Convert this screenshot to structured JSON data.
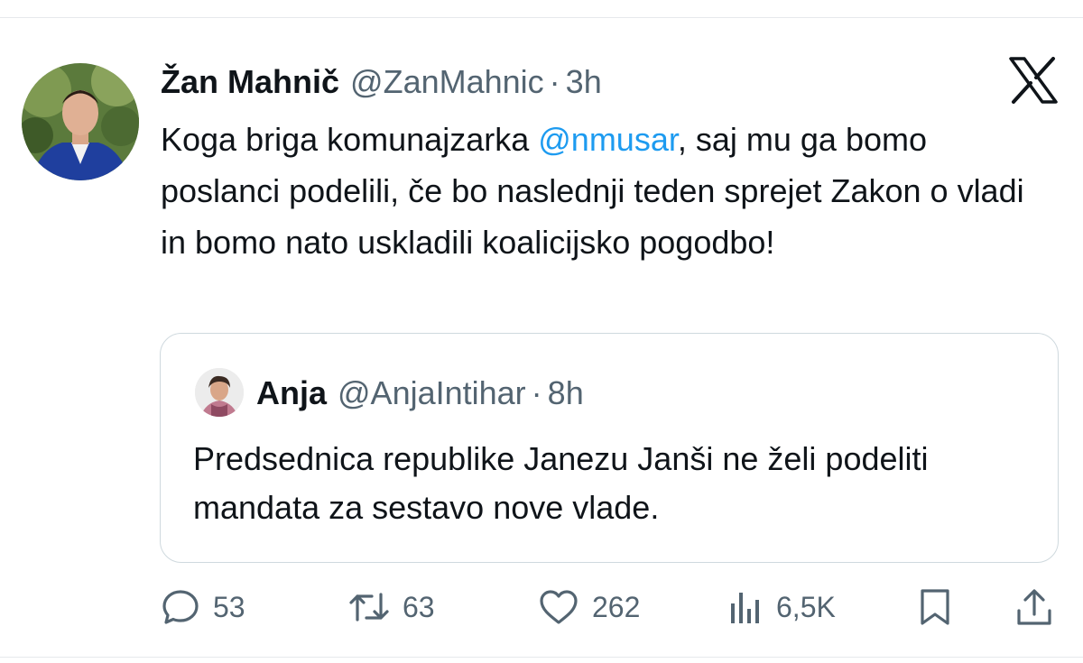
{
  "tweet": {
    "author_name": "Žan Mahnič",
    "author_handle": "@ZanMahnic",
    "separator": "·",
    "time": "3h",
    "text_before_mention": "Koga briga komunajzarka ",
    "mention": "@nmusar",
    "text_after_mention": ", saj mu ga bomo poslanci podelili, če bo naslednji teden sprejet Zakon o vladi in bomo nato uskladili koalicijsko pogodbo!"
  },
  "quoted_tweet": {
    "author_name": "Anja",
    "author_handle": "@AnjaIntihar",
    "separator": "·",
    "time": "8h",
    "text": "Predsednica republike Janezu Janši ne želi podeliti mandata za sestavo nove vlade."
  },
  "actions": {
    "replies": "53",
    "reposts": "63",
    "likes": "262",
    "views": "6,5K"
  },
  "icons": {
    "brand": "x-logo-icon",
    "reply": "reply-icon",
    "repost": "repost-icon",
    "like": "heart-icon",
    "views": "views-icon",
    "bookmark": "bookmark-icon",
    "share": "share-icon"
  },
  "colors": {
    "mention": "#1d9bf0",
    "secondary_text": "#536471",
    "border": "#cfd9de"
  }
}
